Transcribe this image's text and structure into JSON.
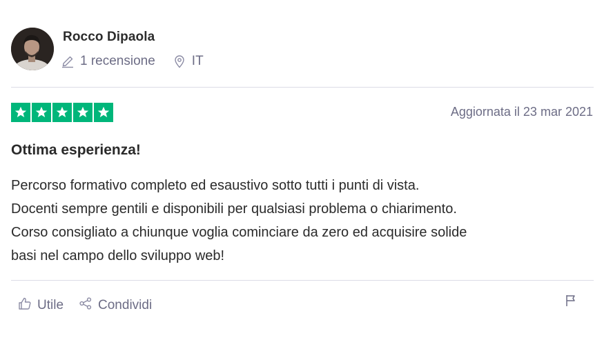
{
  "reviewer": {
    "name": "Rocco Dipaola",
    "reviews_count": "1 recensione",
    "country": "IT",
    "avatar_icon": "user-photo"
  },
  "review": {
    "rating": 5,
    "rating_max": 5,
    "star_color": "#00b67a",
    "date": "Aggiornata il 23 mar 2021",
    "title": "Ottima esperienza!",
    "body_lines": [
      "Percorso formativo completo ed esaustivo sotto tutti i punti di vista.",
      "Docenti sempre gentili e disponibili per qualsiasi problema o chiarimento.",
      "Corso consigliato a chiunque voglia cominciare da zero ed acquisire solide",
      "basi nel campo dello sviluppo web!"
    ]
  },
  "actions": {
    "useful_label": "Utile",
    "useful_icon": "thumbs-up-icon",
    "share_label": "Condividi",
    "share_icon": "share-icon",
    "report_icon": "flag-icon"
  }
}
